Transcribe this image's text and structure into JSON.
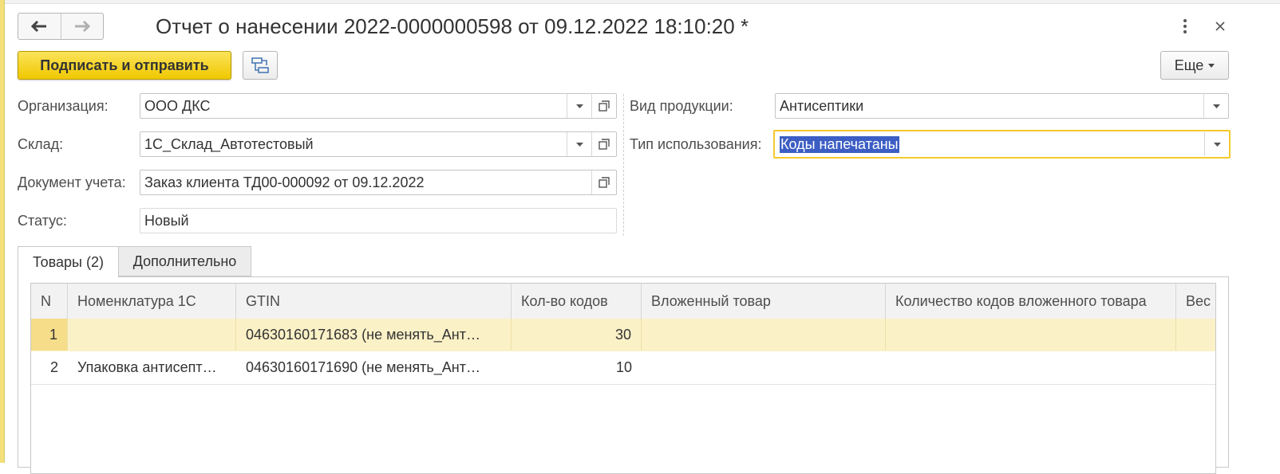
{
  "window": {
    "title": "Отчет о нанесении 2022-0000000598 от 09.12.2022 18:10:20 *"
  },
  "toolbar": {
    "sign_send_label": "Подписать и отправить",
    "more_label": "Еще"
  },
  "form": {
    "organization": {
      "label": "Организация:",
      "value": "ООО ДКС"
    },
    "warehouse": {
      "label": "Склад:",
      "value": "1С_Склад_Автотестовый"
    },
    "document": {
      "label": "Документ учета:",
      "value": "Заказ клиента ТД00-000092 от 09.12.2022"
    },
    "status": {
      "label": "Статус:",
      "value": "Новый"
    },
    "product_type": {
      "label": "Вид продукции:",
      "value": "Антисептики"
    },
    "usage_type": {
      "label": "Тип использования:",
      "value": "Коды напечатаны"
    }
  },
  "tabs": [
    {
      "label": "Товары (2)"
    },
    {
      "label": "Дополнительно"
    }
  ],
  "table": {
    "columns": [
      "N",
      "Номенклатура 1С",
      "GTIN",
      "Кол-во кодов",
      "Вложенный товар",
      "Количество кодов вложенного товара",
      "Вес"
    ],
    "rows": [
      {
        "n": "1",
        "nomenclature": "",
        "gtin": "04630160171683 (не менять_Ант…",
        "codes": "30",
        "nested": "",
        "nested_codes": "",
        "weight": ""
      },
      {
        "n": "2",
        "nomenclature": "Упаковка антисепт…",
        "gtin": "04630160171690 (не менять_Ант…",
        "codes": "10",
        "nested": "",
        "nested_codes": "",
        "weight": ""
      }
    ]
  },
  "colors": {
    "accent_yellow": "#f5c92d",
    "selection_blue": "#3c5ec4",
    "selected_row": "#fbf1c7"
  }
}
